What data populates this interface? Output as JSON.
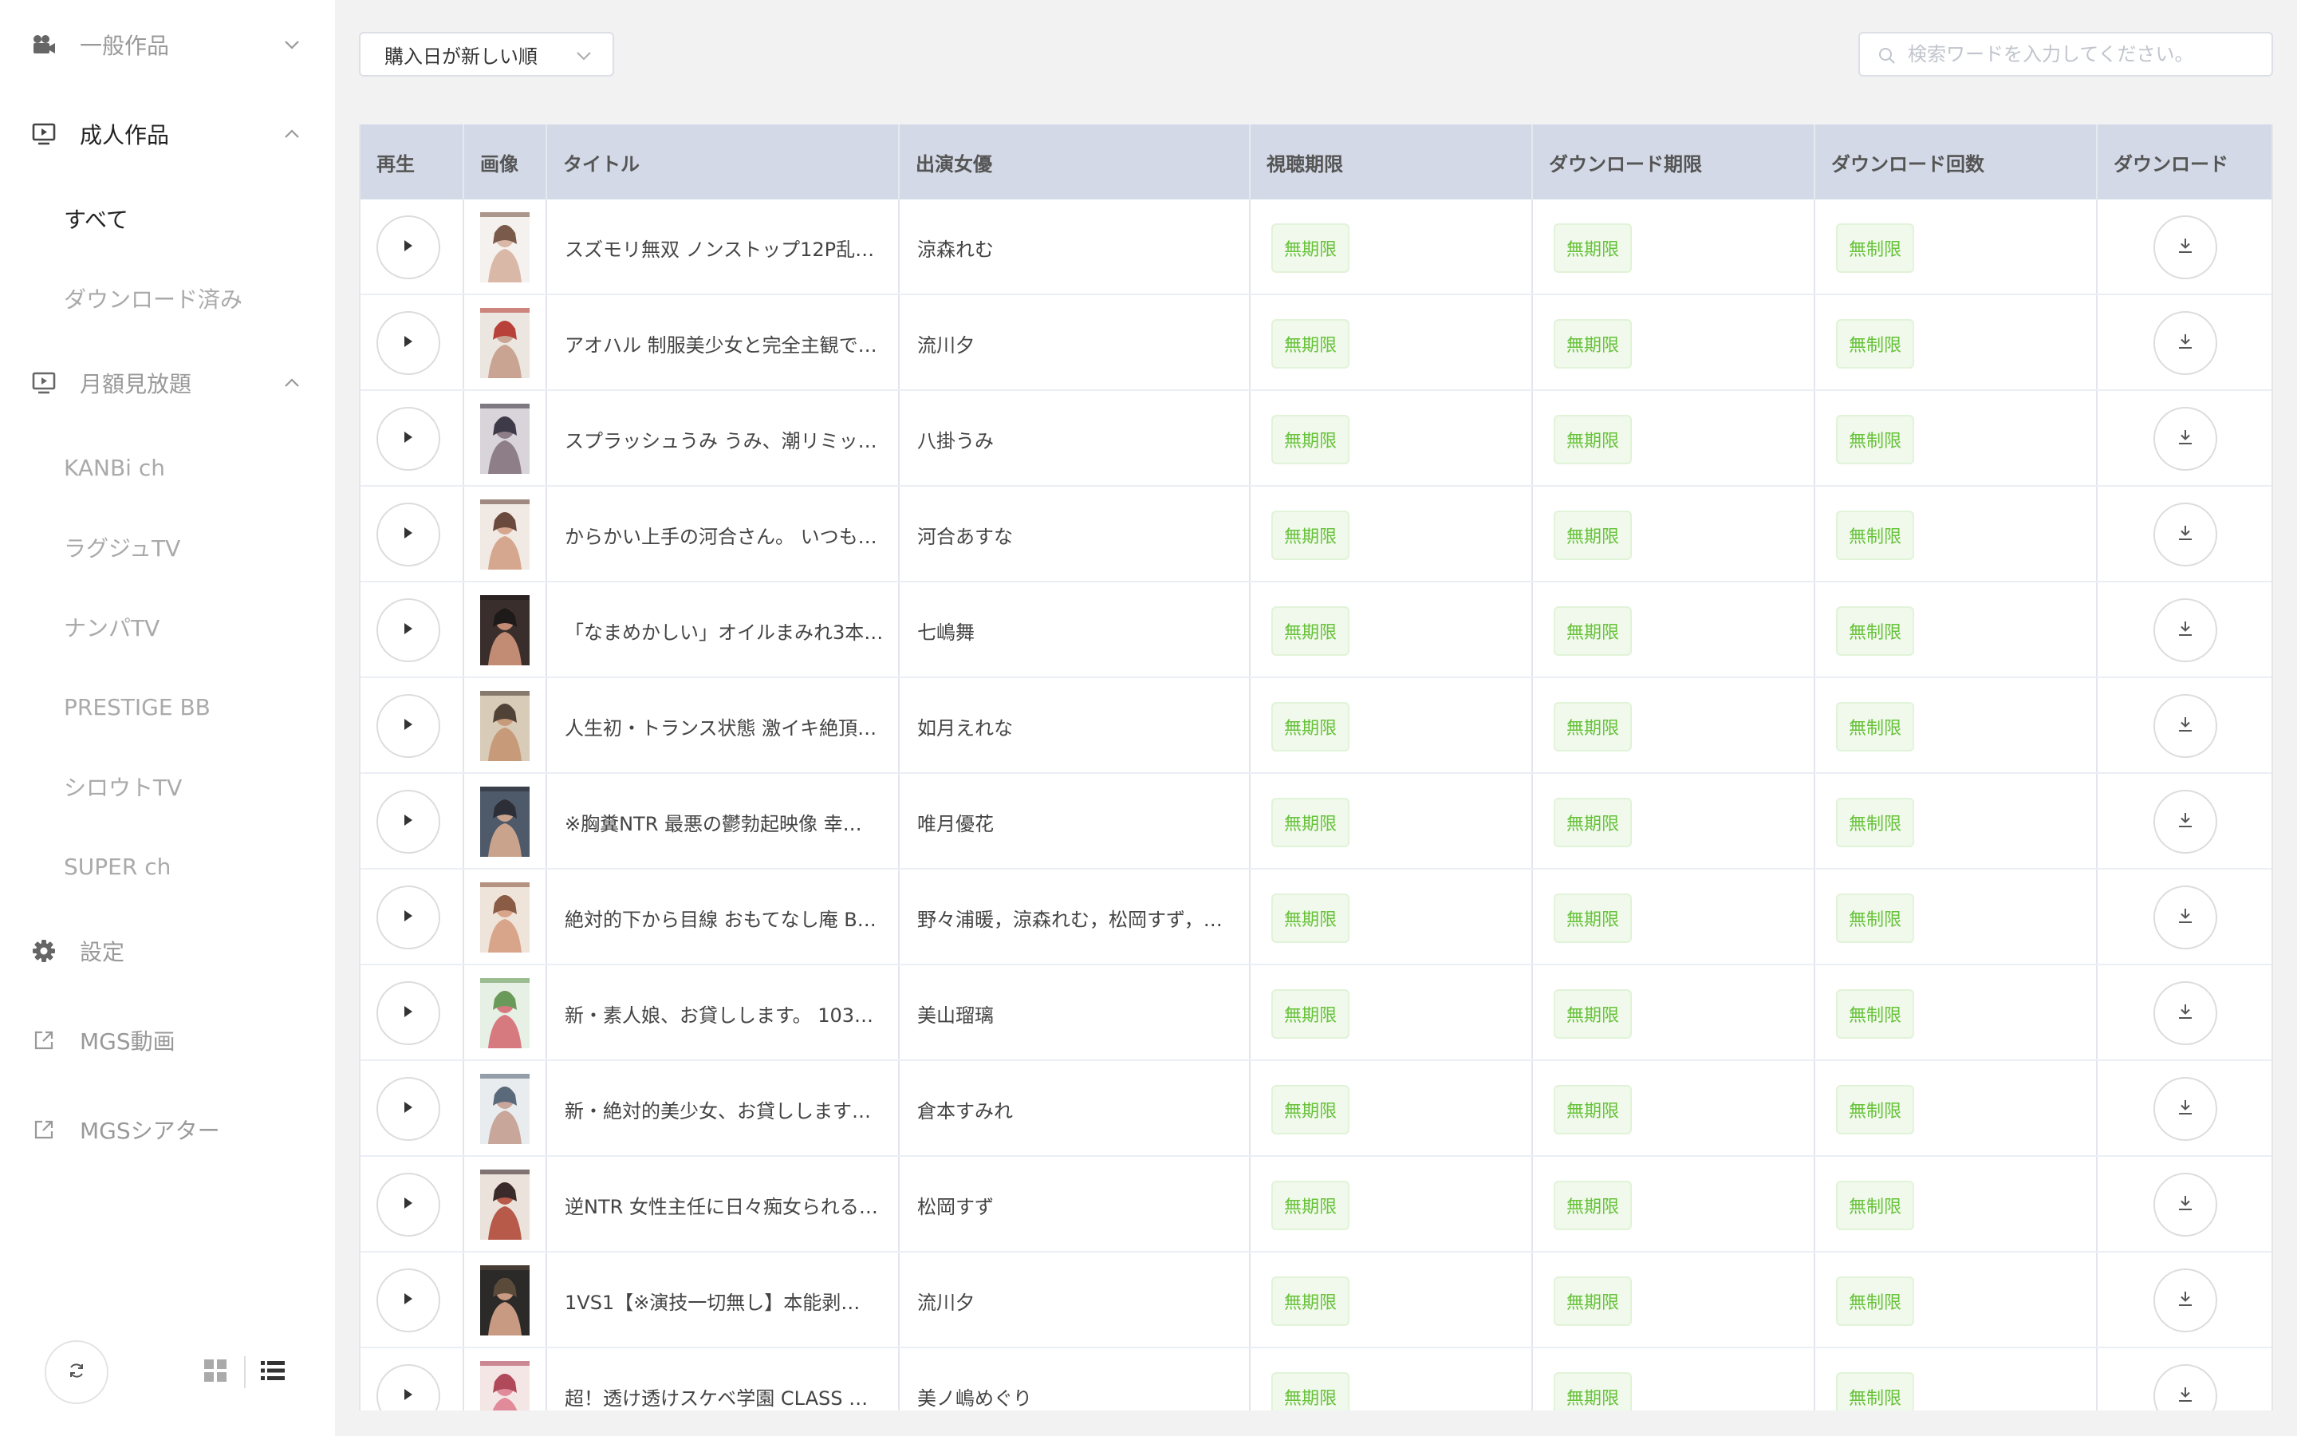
{
  "sidebar": {
    "general": {
      "label": "一般作品"
    },
    "adult": {
      "label": "成人作品"
    },
    "adult_items": [
      "すべて",
      "ダウンロード済み"
    ],
    "monthly": {
      "label": "月額見放題"
    },
    "monthly_items": [
      "KANBi ch",
      "ラグジュTV",
      "ナンパTV",
      "PRESTIGE BB",
      "シロウトTV",
      "SUPER ch"
    ],
    "settings": {
      "label": "設定"
    },
    "link_mgs_video": {
      "label": "MGS動画"
    },
    "link_mgs_theater": {
      "label": "MGSシアター"
    }
  },
  "toolbar": {
    "sort_value": "購入日が新しい順",
    "search_placeholder": "検索ワードを入力してください。"
  },
  "table": {
    "headers": {
      "play": "再生",
      "image": "画像",
      "title": "タイトル",
      "actress": "出演女優",
      "view_limit": "視聴期限",
      "download_limit": "ダウンロード期限",
      "download_count": "ダウンロード回数",
      "download": "ダウンロード"
    },
    "rows": [
      {
        "title": "スズモリ無双 ノンストップ12P乱…",
        "actress": "涼森れむ",
        "view_limit": "無期限",
        "download_limit": "無期限",
        "download_count": "無制限"
      },
      {
        "title": "アオハル 制服美少女と完全主観で…",
        "actress": "流川夕",
        "view_limit": "無期限",
        "download_limit": "無期限",
        "download_count": "無制限"
      },
      {
        "title": "スプラッシュうみ うみ、潮リミッ…",
        "actress": "八掛うみ",
        "view_limit": "無期限",
        "download_limit": "無期限",
        "download_count": "無制限"
      },
      {
        "title": "からかい上手の河合さん。 いつも…",
        "actress": "河合あすな",
        "view_limit": "無期限",
        "download_limit": "無期限",
        "download_count": "無制限"
      },
      {
        "title": "「なまめかしい」オイルまみれ3本…",
        "actress": "七嶋舞",
        "view_limit": "無期限",
        "download_limit": "無期限",
        "download_count": "無制限"
      },
      {
        "title": "人生初・トランス状態 激イキ絶頂…",
        "actress": "如月えれな",
        "view_limit": "無期限",
        "download_limit": "無期限",
        "download_count": "無制限"
      },
      {
        "title": "※胸糞NTR 最悪の鬱勃起映像 幸…",
        "actress": "唯月優花",
        "view_limit": "無期限",
        "download_limit": "無期限",
        "download_count": "無制限"
      },
      {
        "title": "絶対的下から目線 おもてなし庵 B…",
        "actress": "野々浦暖，涼森れむ，松岡すず，…",
        "view_limit": "無期限",
        "download_limit": "無期限",
        "download_count": "無制限"
      },
      {
        "title": "新・素人娘、お貸しします。 103…",
        "actress": "美山瑠璃",
        "view_limit": "無期限",
        "download_limit": "無期限",
        "download_count": "無制限"
      },
      {
        "title": "新・絶対的美少女、お貸しします…",
        "actress": "倉本すみれ",
        "view_limit": "無期限",
        "download_limit": "無期限",
        "download_count": "無制限"
      },
      {
        "title": "逆NTR 女性主任に日々痴女られる…",
        "actress": "松岡すず",
        "view_limit": "無期限",
        "download_limit": "無期限",
        "download_count": "無制限"
      },
      {
        "title": "1VS1【※演技一切無し】本能剥…",
        "actress": "流川夕",
        "view_limit": "無期限",
        "download_limit": "無期限",
        "download_count": "無制限"
      },
      {
        "title": "超！透け透けスケベ学園 CLASS …",
        "actress": "美ノ嶋めぐり",
        "view_limit": "無期限",
        "download_limit": "無期限",
        "download_count": "無制限"
      }
    ]
  },
  "icons": {
    "general": "video-camera-icon",
    "adult": "monitor-play-icon",
    "monthly": "monitor-play-icon",
    "settings": "gear-icon",
    "external": "external-link-icon",
    "refresh": "refresh-icon",
    "grid": "grid-view-icon",
    "list": "list-view-icon",
    "play": "play-icon",
    "download": "download-icon",
    "search": "search-icon"
  },
  "colors": {
    "tag_text": "#67c23a",
    "tag_bg": "#f0f9eb",
    "header_bg": "#d3d9e6"
  }
}
